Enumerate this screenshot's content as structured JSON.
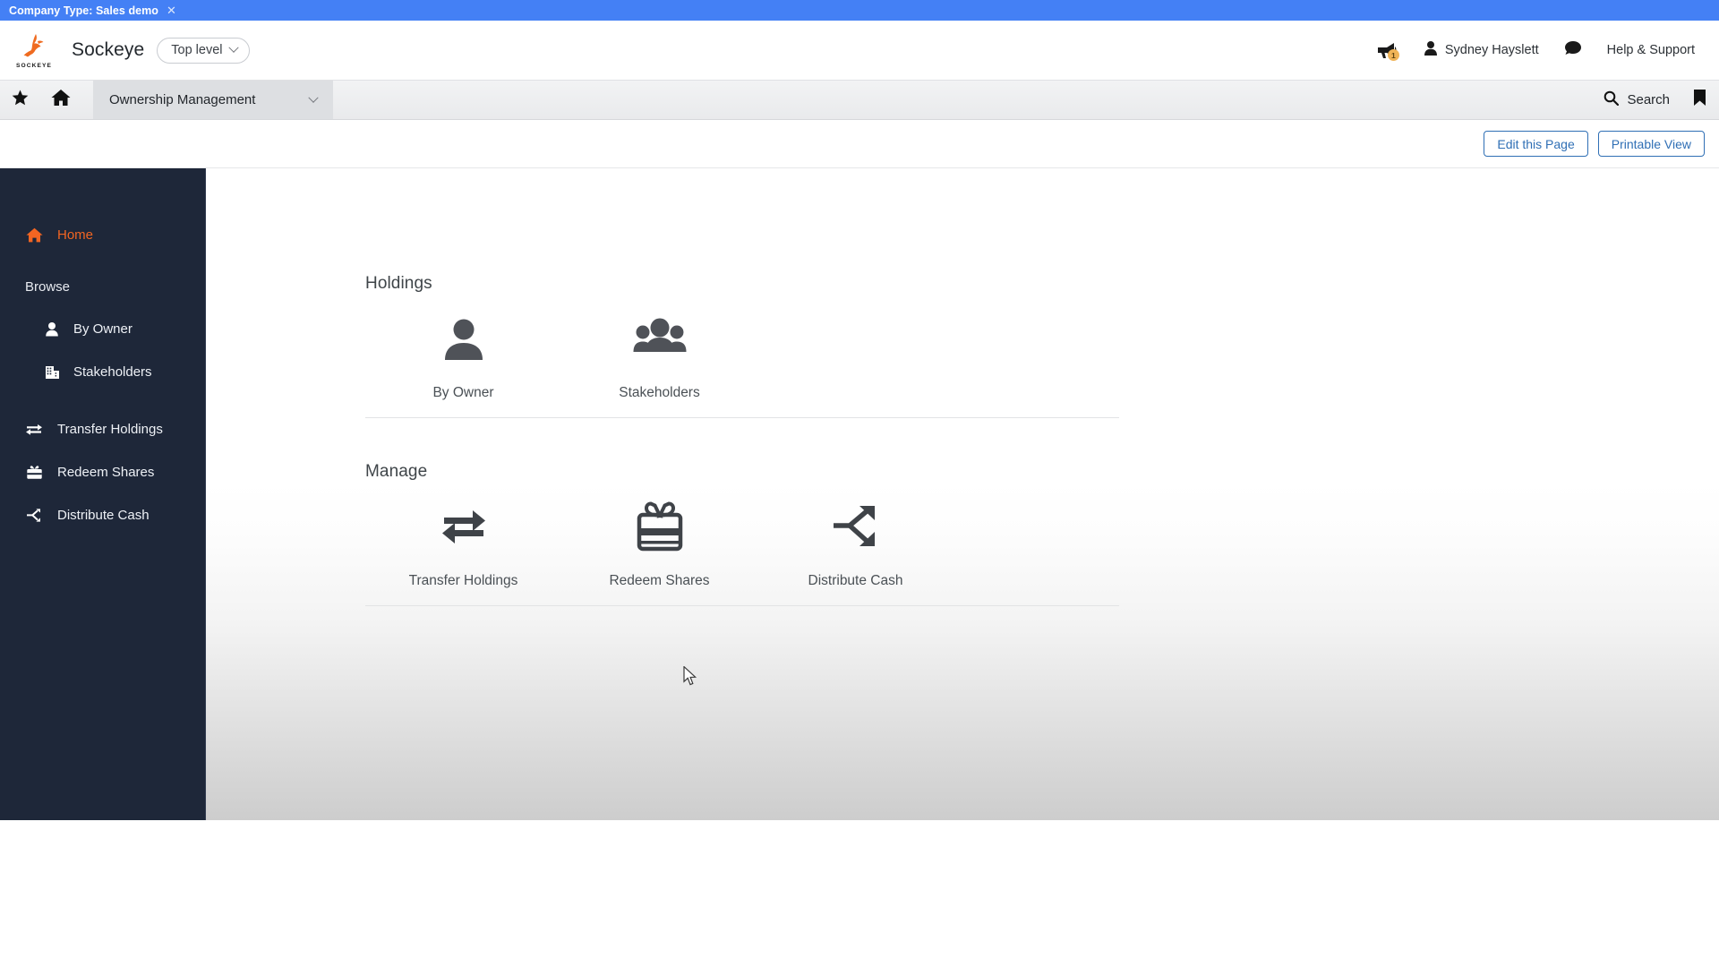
{
  "banner": {
    "text": "Company Type: Sales demo",
    "close_label": "✕",
    "color": "#4480f5"
  },
  "header": {
    "logo_word": "SOCKEYE",
    "brand_name": "Sockeye",
    "scope": {
      "label": "Top level",
      "icon": "chevron-down-icon"
    },
    "notifications": {
      "icon": "megaphone-icon",
      "badge_count": "1",
      "badge_color": "#f0b458"
    },
    "user": {
      "icon": "person-icon",
      "name": "Sydney Hayslett"
    },
    "chat": {
      "icon": "speech-bubble-icon"
    },
    "help": {
      "label": "Help & Support"
    }
  },
  "nav": {
    "favorite_icon": "star-icon",
    "home_icon": "home-icon",
    "tab": {
      "label": "Ownership Management",
      "icon": "chevron-down-icon"
    },
    "search": {
      "label": "Search",
      "icon": "search-icon"
    },
    "bookmark_icon": "bookmark-icon"
  },
  "toolbar": {
    "edit_label": "Edit this Page",
    "print_label": "Printable View",
    "accent": "#2f6fb5"
  },
  "sidebar": {
    "background": "#1e2739",
    "active_color": "#f26522",
    "home": {
      "label": "Home",
      "icon": "home-icon"
    },
    "browse_label": "Browse",
    "browse_items": [
      {
        "label": "By Owner",
        "icon": "person-icon"
      },
      {
        "label": "Stakeholders",
        "icon": "building-icon"
      }
    ],
    "manage_items": [
      {
        "label": "Transfer Holdings",
        "icon": "transfer-arrows-icon"
      },
      {
        "label": "Redeem Shares",
        "icon": "gift-icon"
      },
      {
        "label": "Distribute Cash",
        "icon": "branch-arrows-icon"
      }
    ]
  },
  "main": {
    "sections": [
      {
        "title": "Holdings",
        "tiles": [
          {
            "label": "By Owner",
            "icon": "person-large-icon"
          },
          {
            "label": "Stakeholders",
            "icon": "group-people-icon"
          }
        ]
      },
      {
        "title": "Manage",
        "tiles": [
          {
            "label": "Transfer Holdings",
            "icon": "transfer-arrows-icon"
          },
          {
            "label": "Redeem Shares",
            "icon": "gift-icon"
          },
          {
            "label": "Distribute Cash",
            "icon": "branch-arrows-icon"
          }
        ]
      }
    ]
  }
}
